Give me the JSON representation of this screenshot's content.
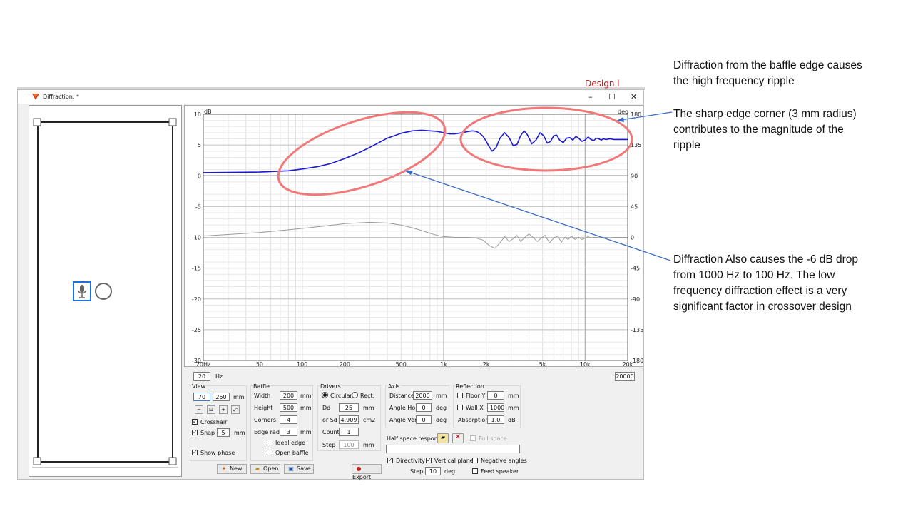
{
  "annotations": {
    "top": [
      "Diffraction from the baffle edge causes",
      "the high frequency ripple"
    ],
    "middle": [
      "The sharp edge corner (3 mm radius)",
      "contributes to the magnitude of the",
      "ripple"
    ],
    "bottom": [
      "Diffraction Also causes the -6 dB drop",
      "from 1000 Hz  to 100 Hz.  The low",
      "frequency diffraction effect is a very",
      "significant factor in crossover design"
    ]
  },
  "window": {
    "title": "Diffraction: *",
    "minimize": "–",
    "maximize": "☐",
    "close": "✕",
    "behind_text": "Design  l"
  },
  "chart_data": {
    "type": "line",
    "xlabel": "",
    "ylabel": "dB",
    "y2label": "deg",
    "xscale": "log",
    "xlim": [
      20,
      20000
    ],
    "ylim": [
      -30,
      10
    ],
    "y2lim": [
      -180,
      180
    ],
    "x_ticks": [
      "20Hz",
      "50",
      "100",
      "200",
      "500",
      "1k",
      "2k",
      "5k",
      "10k",
      "20k"
    ],
    "x_tick_values": [
      20,
      50,
      100,
      200,
      500,
      1000,
      2000,
      5000,
      10000,
      20000
    ],
    "y_ticks": [
      "10",
      "5",
      "0",
      "-5",
      "-10",
      "-15",
      "-20",
      "-25",
      "-30"
    ],
    "y_tick_values": [
      10,
      5,
      0,
      -5,
      -10,
      -15,
      -20,
      -25,
      -30
    ],
    "y2_ticks": [
      "180",
      "135",
      "90",
      "45",
      "0",
      "-45",
      "-90",
      "-135",
      "-180"
    ],
    "y2_tick_values": [
      180,
      135,
      90,
      45,
      0,
      -45,
      -90,
      -135,
      -180
    ],
    "grid": true,
    "series": [
      {
        "color": "#1a1ad0",
        "axis": "left",
        "x": [
          20,
          50,
          80,
          100,
          130,
          160,
          200,
          250,
          300,
          350,
          400,
          500,
          600,
          700,
          800,
          900,
          1000,
          1100,
          1200,
          1350,
          1500,
          1600,
          1700,
          1800,
          1900,
          2000,
          2100,
          2200,
          2350,
          2500,
          2700,
          2900,
          3100,
          3300,
          3500,
          3700,
          3900,
          4200,
          4500,
          4800,
          5100,
          5400,
          5700,
          6000,
          6300,
          6600,
          7000,
          7400,
          7800,
          8200,
          8600,
          9000,
          9500,
          10000,
          10500,
          11000,
          11500,
          12000,
          12500,
          13000,
          13500,
          14000,
          15000,
          16000,
          17000,
          18000,
          19000,
          20000
        ],
        "values": [
          0.5,
          0.6,
          0.8,
          1.1,
          1.5,
          2.0,
          2.8,
          3.7,
          4.6,
          5.4,
          6.1,
          6.9,
          7.3,
          7.4,
          7.3,
          7.2,
          7.0,
          6.8,
          6.8,
          7.0,
          7.2,
          7.3,
          7.2,
          6.9,
          6.4,
          5.6,
          4.7,
          4.0,
          4.6,
          6.1,
          7.0,
          6.2,
          4.9,
          5.1,
          6.5,
          7.3,
          6.7,
          5.2,
          5.8,
          7.0,
          6.5,
          5.3,
          5.6,
          6.5,
          6.6,
          5.8,
          5.4,
          6.1,
          6.2,
          5.8,
          6.4,
          6.1,
          5.6,
          5.8,
          6.3,
          5.9,
          5.7,
          6.1,
          6.0,
          5.8,
          6.0,
          5.9,
          6.0,
          5.9,
          5.9,
          5.9,
          5.9,
          5.9
        ]
      },
      {
        "color": "#9a9a9a",
        "axis": "right",
        "x": [
          20,
          50,
          100,
          150,
          200,
          300,
          400,
          500,
          600,
          700,
          800,
          900,
          1000,
          1200,
          1500,
          1700,
          1900,
          2000,
          2100,
          2300,
          2500,
          2700,
          2900,
          3100,
          3300,
          3500,
          3700,
          4000,
          4300,
          4600,
          4900,
          5200,
          5600,
          6000,
          6400,
          6800,
          7200,
          7600,
          8000,
          8500,
          9000,
          9500,
          10000,
          10500,
          11000,
          11500,
          12000,
          13000,
          14000,
          15000,
          16000,
          17000,
          18000,
          19000,
          20000
        ],
        "values": [
          2,
          7,
          13,
          17,
          20,
          22,
          21,
          18,
          14,
          10,
          6,
          3,
          1,
          0,
          0,
          -1,
          -4,
          -8,
          -12,
          -16,
          -8,
          1,
          -6,
          -2,
          3,
          -6,
          -1,
          5,
          0,
          -6,
          -1,
          3,
          -8,
          -1,
          2,
          -7,
          0,
          -3,
          2,
          -3,
          0,
          -3,
          -1,
          1,
          -1,
          0,
          0,
          -1,
          0,
          -1,
          0,
          0,
          0,
          0,
          0
        ]
      }
    ]
  },
  "freq": {
    "min": "20",
    "unit": "Hz",
    "max": "20000"
  },
  "view": {
    "title": "View",
    "x": "70",
    "y": "250",
    "unit": "mm",
    "crosshair": "Crosshair",
    "snap": "Snap",
    "snap_value": "5",
    "snap_unit": "mm",
    "show_phase": "Show phase"
  },
  "baffle": {
    "title": "Baffle",
    "width_label": "Width",
    "width": "200",
    "width_unit": "mm",
    "height_label": "Height",
    "height": "500",
    "height_unit": "mm",
    "corners_label": "Corners",
    "corners": "4",
    "edge_label": "Edge rad.",
    "edge": "3",
    "edge_unit": "mm",
    "ideal_edge": "Ideal edge",
    "open_baffle": "Open baffle"
  },
  "drivers": {
    "title": "Drivers",
    "circular": "Circular",
    "rect": "Rect.",
    "dd_label": "Dd",
    "dd": "25",
    "dd_unit": "mm",
    "sd_label": "or Sd",
    "sd": "4.909",
    "sd_unit": "cm2",
    "count_label": "Count",
    "count": "1",
    "step_label": "Step",
    "step": "100",
    "step_unit": "mm"
  },
  "axis": {
    "title": "Axis",
    "distance_label": "Distance",
    "distance": "2000",
    "distance_unit": "mm",
    "hor_label": "Angle Hor",
    "hor": "0",
    "hor_unit": "deg",
    "ver_label": "Angle Ver",
    "ver": "0",
    "ver_unit": "deg"
  },
  "reflection": {
    "title": "Reflection",
    "floor_label": "Floor Y",
    "floor": "0",
    "floor_unit": "mm",
    "wall_label": "Wall  X",
    "wall": "-1000",
    "wall_unit": "mm",
    "absorption_label": "Absorption",
    "absorption": "1.0",
    "absorption_unit": "dB"
  },
  "half_space": {
    "label": "Half space response",
    "full_space": "Full space",
    "value": ""
  },
  "options": {
    "directivity": "Directivity",
    "vertical_plane": "Vertical plane",
    "negative_angles": "Negative angles",
    "step_label": "Step",
    "step": "10",
    "step_unit": "deg",
    "feed_speaker": "Feed speaker"
  },
  "buttons": {
    "new": "New",
    "open": "Open",
    "save": "Save",
    "export": "Export"
  }
}
